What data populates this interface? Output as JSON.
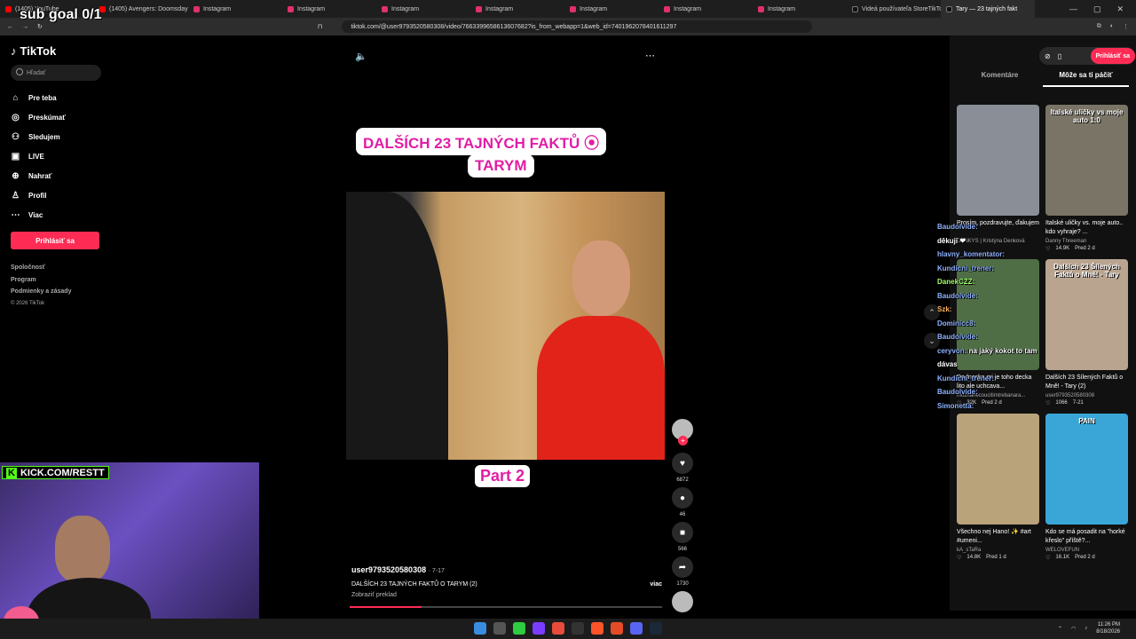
{
  "overlay": {
    "sub_goal": "sub goal 0/1",
    "kick_url": "KICK.COM/RESTT",
    "kick_k": "K"
  },
  "browser": {
    "tabs": [
      {
        "label": "(1405) YouTube",
        "fav": "yt"
      },
      {
        "label": "(1405) Avengers: Doomsday |",
        "fav": "yt"
      },
      {
        "label": "Instagram",
        "fav": "ig"
      },
      {
        "label": "Instagram",
        "fav": "ig"
      },
      {
        "label": "Instagram",
        "fav": "ig"
      },
      {
        "label": "Instagram",
        "fav": "ig"
      },
      {
        "label": "Instagram",
        "fav": "ig"
      },
      {
        "label": "Instagram",
        "fav": "ig"
      },
      {
        "label": "Instagram",
        "fav": "ig"
      },
      {
        "label": "Videá používateľa StoreTikTok",
        "fav": "tt"
      },
      {
        "label": "Tary — 23 tajných fakt",
        "fav": "tt",
        "active": true
      }
    ],
    "url": "tiktok.com/@user9793520580308/video/7663399658613607682?is_from_webapp=1&web_id=7401962078401611297"
  },
  "sidebar": {
    "logo": "TikTok",
    "search_placeholder": "Hľadať",
    "items": [
      {
        "icon": "⌂",
        "label": "Pre teba"
      },
      {
        "icon": "◎",
        "label": "Preskúmať"
      },
      {
        "icon": "⚇",
        "label": "Sledujem"
      },
      {
        "icon": "▣",
        "label": "LIVE"
      },
      {
        "icon": "⊕",
        "label": "Nahrať"
      },
      {
        "icon": "♙",
        "label": "Profil"
      },
      {
        "icon": "⋯",
        "label": "Viac"
      }
    ],
    "login": "Prihlásiť sa",
    "footer": [
      "Spoločnosť",
      "Program",
      "Podmienky a zásady"
    ],
    "copyright": "© 2026 TikTok"
  },
  "video": {
    "title_line1": "DALŠÍCH 23 TAJNÝCH FAKTŮ",
    "title_line2": "TARYM",
    "part": "Part 2",
    "author": "user9793520580308",
    "date": "· 7-17",
    "description": "DALŠÍCH 23 TAJNÝCH FAKTŮ O TARYM (2)",
    "more": "viac",
    "translate": "Zobraziť preklad",
    "progress_fraction": 0.23
  },
  "actions": [
    {
      "icon": "♥",
      "count": "6872",
      "name": "like"
    },
    {
      "icon": "●",
      "count": "46",
      "name": "comment"
    },
    {
      "icon": "■",
      "count": "566",
      "name": "save"
    },
    {
      "icon": "➦",
      "count": "1730",
      "name": "share"
    }
  ],
  "right_panel": {
    "login": "Prihlásiť sa",
    "tabs": [
      "Komentáre",
      "Môže sa ti páčiť"
    ],
    "active_tab": 1,
    "cards": [
      {
        "thumb_text": "",
        "title": "Prosím, pozdravujte, ďakujem",
        "author": "DENKYS | Kristýna Denková",
        "likes": "",
        "age": "",
        "color": "#8a8f97"
      },
      {
        "thumb_text": "Italské uličky vs moje auto 1:0",
        "title": "Italské uličky vs. moje auto.. kdo vyhraje? ...",
        "author": "Danny Threeman",
        "likes": "14.9K",
        "age": "Pred 2 d",
        "color": "#7a7466"
      },
      {
        "thumb_text": "",
        "title": "Dodneska mi je toho decka lito ale uchcava...",
        "author": "moznanecoucitimtrebanara...",
        "likes": "32K",
        "age": "Pred 2 d",
        "color": "#4f6e46"
      },
      {
        "thumb_text": "Dalších 23 Šílených Faktů o Mně! - Tary",
        "title": "Dalších 23 Šílených Faktů o Mně! - Tary (2)",
        "author": "user9793520580308",
        "likes": "1066",
        "age": "7-21",
        "color": "#b9a490"
      },
      {
        "thumb_text": "",
        "title": "Všechno nej Hano! ✨ #art #umeni...",
        "author": "kA_sTaRa",
        "likes": "14.8K",
        "age": "Pred 1 d",
        "color": "#b9a37a"
      },
      {
        "thumb_text": "PAIN",
        "title": "Kdo se má posadit na \"horké křeslo\" příště?...",
        "author": "WELOVEFUN",
        "likes": "16.1K",
        "age": "Pred 2 d",
        "color": "#3aa6d8"
      }
    ]
  },
  "chat": [
    {
      "user": "Baudolvide:",
      "msg": "",
      "cls": "u"
    },
    {
      "user": "",
      "msg": "děkuji ❤",
      "cls": "u"
    },
    {
      "user": "hlavny_komentator:",
      "msg": "",
      "cls": "u"
    },
    {
      "user": "Kundicni_trener:",
      "msg": "",
      "cls": "u"
    },
    {
      "user": "DanekCZZ:",
      "msg": "",
      "cls": "u2"
    },
    {
      "user": "Baudolvide:",
      "msg": "",
      "cls": "u"
    },
    {
      "user": "Szk:",
      "msg": "",
      "cls": "u3"
    },
    {
      "user": "Dominicc8:",
      "msg": "",
      "cls": "u"
    },
    {
      "user": "Baudolvide:",
      "msg": "",
      "cls": "u"
    },
    {
      "user": "ceryvon:",
      "msg": "na jaký kokot to tam dávas",
      "cls": "u"
    },
    {
      "user": "Kundicni_trener:",
      "msg": "",
      "cls": "u"
    },
    {
      "user": "Baudolvide:",
      "msg": "",
      "cls": "u"
    },
    {
      "user": "Simonetta:",
      "msg": "",
      "cls": "u"
    }
  ],
  "taskbar": {
    "time": "11:26 PM",
    "date": "8/18/2026",
    "icon_colors": [
      "#3a8dde",
      "#555",
      "#2ecc40",
      "#7a3cff",
      "#e74c3c",
      "#333",
      "#fb542b",
      "#e34c26",
      "#5865f2",
      "#1b2838"
    ]
  }
}
